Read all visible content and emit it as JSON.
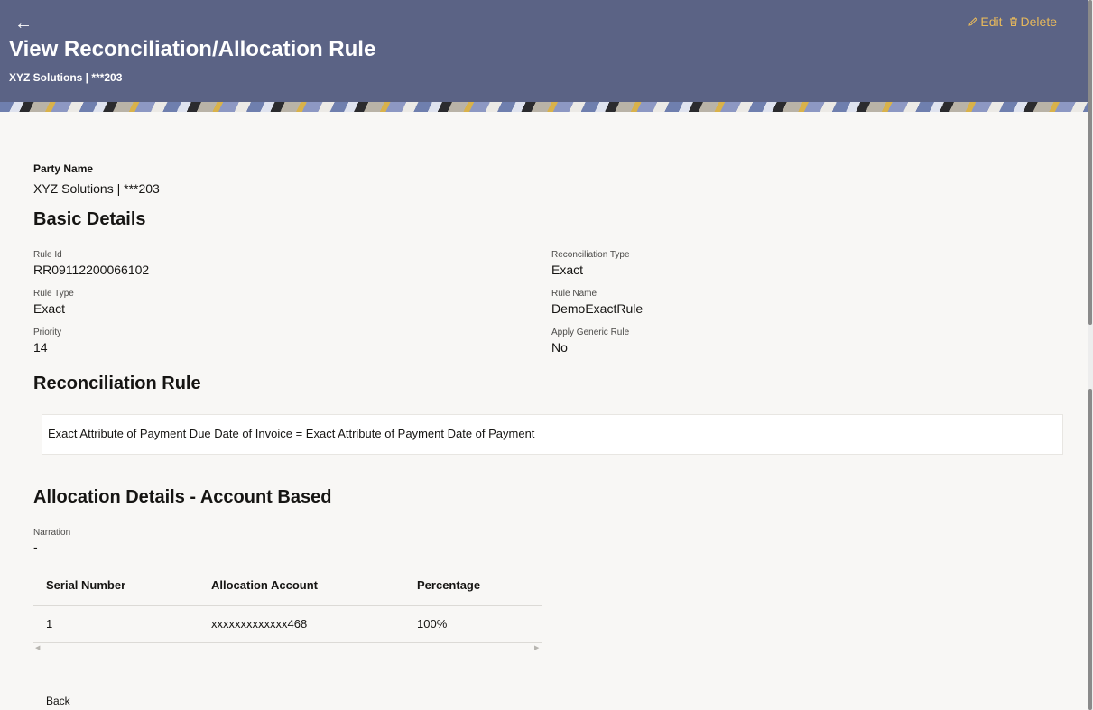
{
  "header": {
    "back_glyph": "←",
    "title": "View Reconciliation/Allocation Rule",
    "subtitle": "XYZ Solutions | ***203",
    "edit_label": "Edit",
    "delete_label": "Delete",
    "accent_color": "#e6b85c",
    "bg_color": "#5b6385"
  },
  "party": {
    "label": "Party Name",
    "value": "XYZ Solutions | ***203"
  },
  "basic_details": {
    "title": "Basic Details",
    "rule_id_label": "Rule Id",
    "rule_id_value": "RR09112200066102",
    "rule_type_label": "Rule Type",
    "rule_type_value": "Exact",
    "priority_label": "Priority",
    "priority_value": "14",
    "recon_type_label": "Reconciliation Type",
    "recon_type_value": "Exact",
    "rule_name_label": "Rule Name",
    "rule_name_value": "DemoExactRule",
    "apply_generic_label": "Apply Generic Rule",
    "apply_generic_value": "No"
  },
  "reconciliation_rule": {
    "title": "Reconciliation Rule",
    "expression": "Exact Attribute of Payment Due Date of Invoice = Exact Attribute of Payment Date of Payment"
  },
  "allocation": {
    "title": "Allocation Details - Account Based",
    "narration_label": "Narration",
    "narration_value": "-",
    "columns": [
      "Serial Number",
      "Allocation Account",
      "Percentage"
    ],
    "rows": [
      [
        "1",
        "xxxxxxxxxxxxx468",
        "100%"
      ]
    ]
  },
  "footer": {
    "back_label": "Back"
  }
}
